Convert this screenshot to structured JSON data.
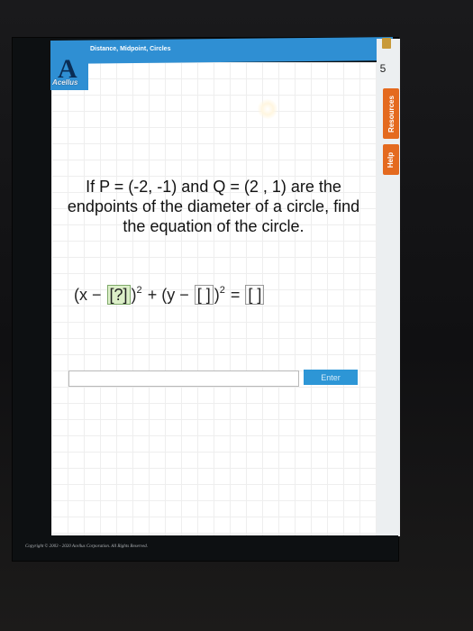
{
  "header": {
    "title": "Distance, Midpoint, Circles"
  },
  "logo": {
    "glyph": "A",
    "word": "Acellus"
  },
  "side": {
    "page_number": "5",
    "resources_label": "Resources",
    "help_label": "Help"
  },
  "problem": {
    "text": "If P = (-2, -1) and Q = (2 , 1) are the endpoints of the diameter of a circle, find the equation of the circle."
  },
  "equation": {
    "open1": "(x −",
    "slot1": "[?]",
    "close1": ")",
    "sup1": "2",
    "plus": "+ (y −",
    "slot2": "[ ]",
    "close2": ")",
    "sup2": "2",
    "equals": "=",
    "slot3": "[ ]"
  },
  "answer": {
    "value": "",
    "placeholder": ""
  },
  "enter_label": "Enter",
  "footer": {
    "copyright": "Copyright © 2003 - 2020 Acellus Corporation. All Rights Reserved."
  },
  "colors": {
    "accent": "#2f8fd3",
    "tab": "#e46a1f",
    "active_slot": "#dcefc8"
  }
}
